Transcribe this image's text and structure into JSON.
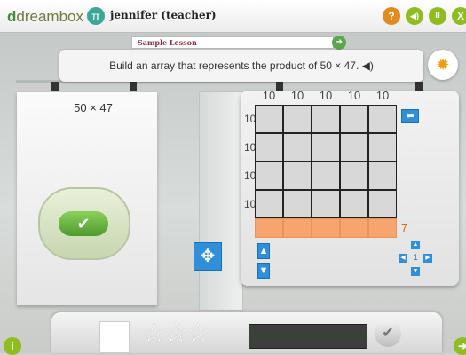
{
  "header": {
    "logo_text": "dreambox",
    "user_label": "jennifer (teacher)",
    "buttons": [
      {
        "name": "help",
        "glyph": "?",
        "color": "#e38a1e"
      },
      {
        "name": "sound",
        "glyph": "◀)",
        "color": "#8dbd1e"
      },
      {
        "name": "pause",
        "glyph": "II",
        "color": "#8dbd1e"
      },
      {
        "name": "close",
        "glyph": "X",
        "color": "#8dbd1e"
      }
    ]
  },
  "lesson": {
    "tab_label": "Sample Lesson",
    "instruction": "Build an array that represents the product of 50 × 47. ◀)",
    "problem": "50 × 47"
  },
  "grid": {
    "column_labels": [
      "10",
      "10",
      "10",
      "10",
      "10"
    ],
    "row_labels": [
      "10",
      "10",
      "10",
      "10"
    ],
    "partial_row_label": "7",
    "rows": 4,
    "cols": 5
  },
  "stepper": {
    "value": "1"
  },
  "icons": {
    "bulb": "lightbulb-icon",
    "check": "checkmark-icon",
    "move": "move-arrows-icon",
    "back": "left-arrow-icon",
    "up": "up-arrow-icon",
    "down": "down-arrow-icon",
    "info": "info-icon",
    "submit": "check-seal-icon"
  },
  "colors": {
    "accent_orange": "#f7a46f",
    "accent_blue": "#2f8fdb",
    "green": "#4f9a2f"
  }
}
